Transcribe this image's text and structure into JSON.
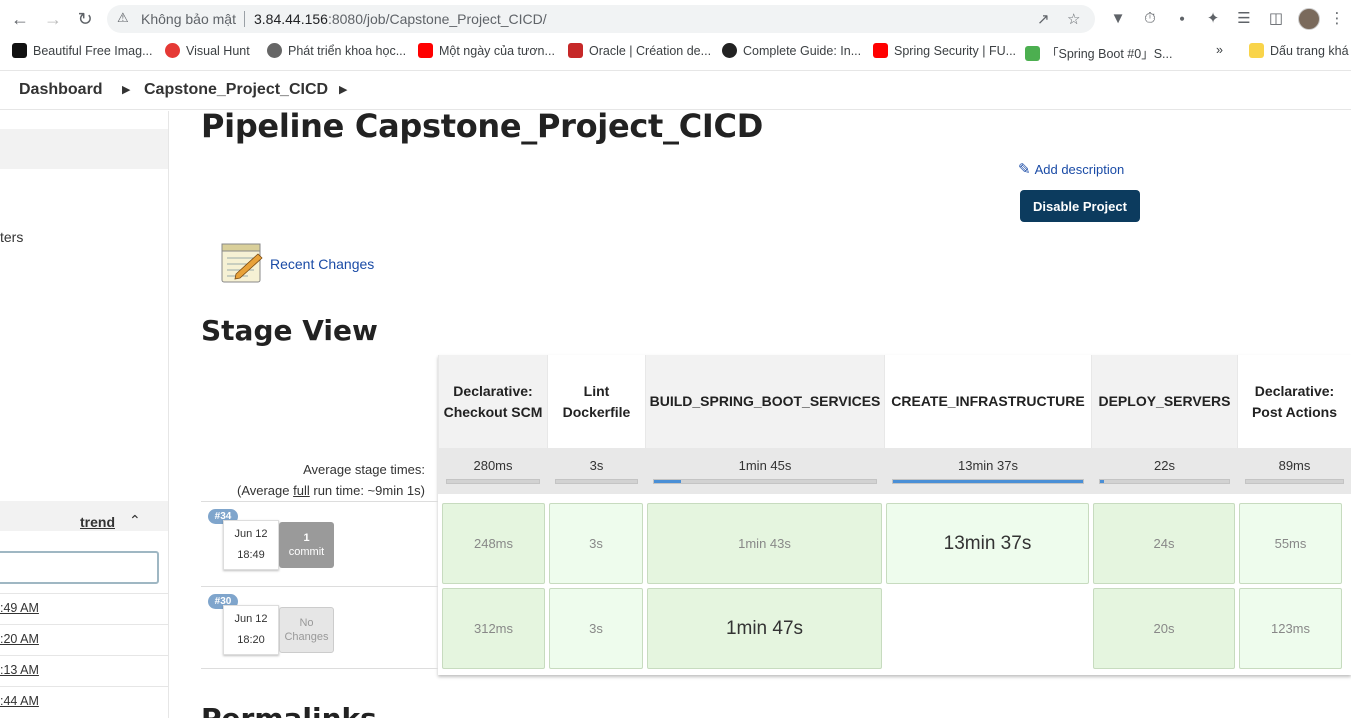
{
  "browser": {
    "insecure_label": "Không bảo mật",
    "url_host": "3.84.44.156",
    "url_rest": ":8080/job/Capstone_Project_CICD/",
    "bookmarks": [
      {
        "label": "Beautiful Free Imag...",
        "color": "#111111"
      },
      {
        "label": "Visual Hunt",
        "color": "#e53935"
      },
      {
        "label": "Phát triển khoa học...",
        "color": "#555555"
      },
      {
        "label": "Một ngày của tươn...",
        "color": "#ff0000"
      },
      {
        "label": "Oracle | Création de...",
        "color": "#c62828"
      },
      {
        "label": "Complete Guide: In...",
        "color": "#222222"
      },
      {
        "label": "Spring Security | FU...",
        "color": "#ff0000"
      },
      {
        "label": "「Spring Boot #0」S...",
        "color": "#4caf50"
      },
      {
        "label": "Dấu trang khá",
        "color": "#f9d44a"
      }
    ],
    "more_bookmarks": "»"
  },
  "breadcrumbs": {
    "dashboard": "Dashboard",
    "project": "Capstone_Project_CICD"
  },
  "sidebar": {
    "partial_item": "ters",
    "trend": "trend",
    "history_times": [
      ":49 AM",
      ":20 AM",
      ":13 AM",
      ":44 AM"
    ]
  },
  "main": {
    "title": "Pipeline Capstone_Project_CICD",
    "add_description": "Add description",
    "disable_project": "Disable Project",
    "recent_changes": "Recent Changes",
    "stage_view_title": "Stage View",
    "permalinks_title": "Permalinks"
  },
  "stage_view": {
    "avg_stage_label": "Average stage times:",
    "avg_run_prefix": "(Average ",
    "avg_run_link": "full",
    "avg_run_suffix": " run time: ~9min 1s)",
    "stages": [
      {
        "name": "Declarative: Checkout SCM",
        "avg": "280ms",
        "bar": 0.0
      },
      {
        "name": "Lint Dockerfile",
        "avg": "3s",
        "bar": 0.0
      },
      {
        "name": "BUILD_SPRING_BOOT_SERVICES",
        "avg": "1min 45s",
        "bar": 0.12
      },
      {
        "name": "CREATE_INFRASTRUCTURE",
        "avg": "13min 37s",
        "bar": 1.0
      },
      {
        "name": "DEPLOY_SERVERS",
        "avg": "22s",
        "bar": 0.02
      },
      {
        "name": "Declarative: Post Actions",
        "avg": "89ms",
        "bar": 0.0
      }
    ],
    "runs": [
      {
        "id": "#34",
        "date": "Jun 12",
        "time": "18:49",
        "changes_count": "1",
        "changes_label": "commit",
        "cells": [
          "248ms",
          "3s",
          "1min 43s",
          "13min 37s",
          "24s",
          "55ms"
        ]
      },
      {
        "id": "#30",
        "date": "Jun 12",
        "time": "18:20",
        "changes_count": "",
        "changes_label": "No Changes",
        "cells": [
          "312ms",
          "3s",
          "1min 47s",
          "",
          "20s",
          "123ms"
        ]
      }
    ]
  },
  "colors": {
    "primary_button": "#0c3b5e",
    "link": "#1a4ba6",
    "success_cell": "#e5f5df",
    "progress": "#4a8fd6"
  }
}
